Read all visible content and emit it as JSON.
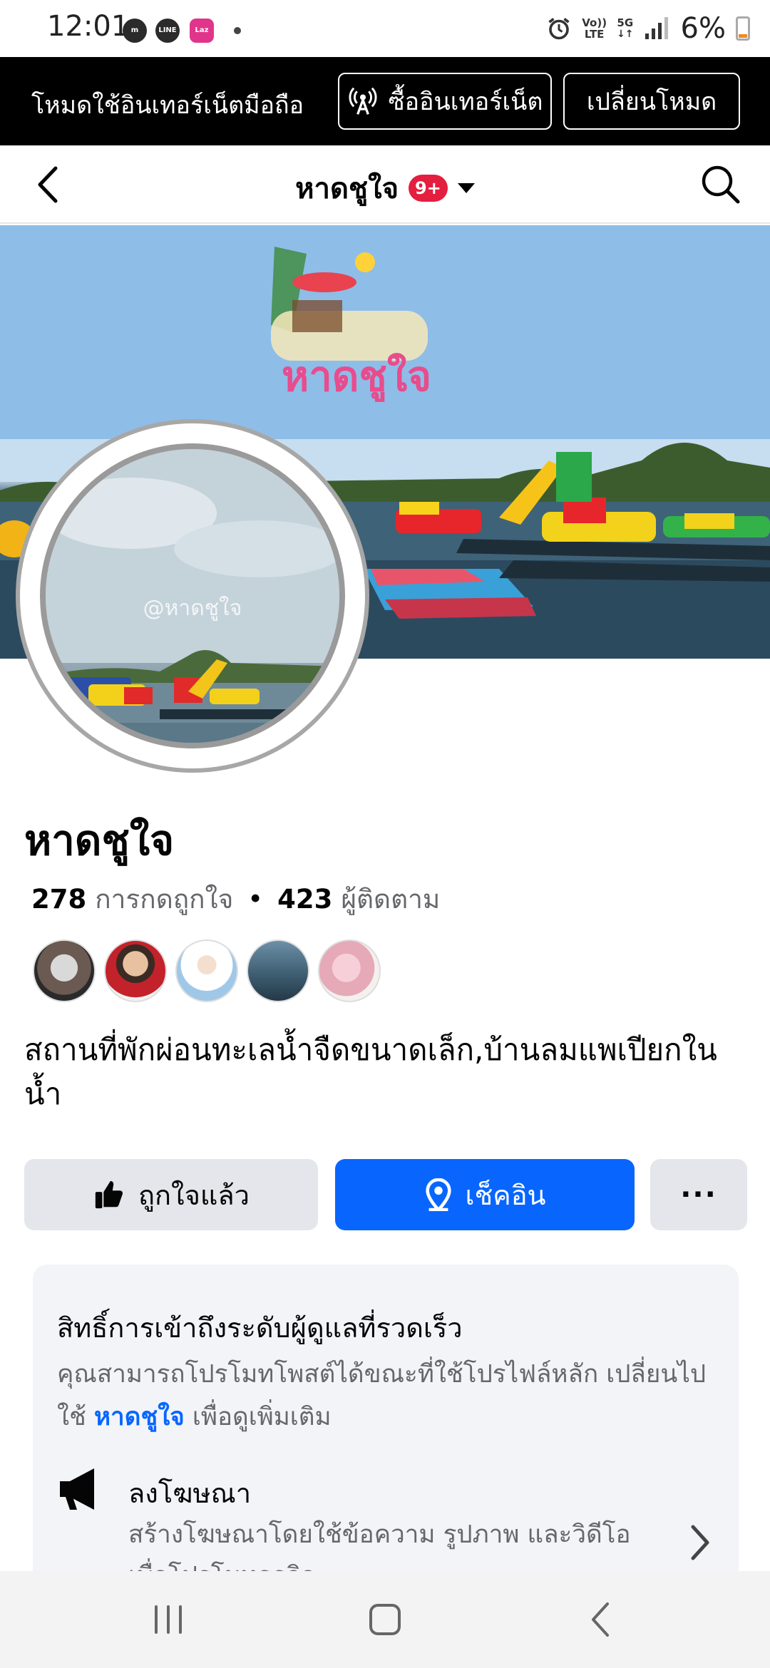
{
  "status_bar": {
    "time": "12:01",
    "apps": [
      "messenger-icon",
      "line-icon",
      "lazada-icon"
    ],
    "network_top": "Vo))",
    "network_bottom": "LTE",
    "five_g": "5G",
    "battery": "6%"
  },
  "mode_banner": {
    "text": "โหมดใช้อินเทอร์เน็ตมือถือ",
    "buy_label": "ซื้ออินเทอร์เน็ต",
    "switch_label": "เปลี่ยนโหมด"
  },
  "header": {
    "title": "หาดชูใจ",
    "badge": "9+"
  },
  "cover": {
    "logo_text": "หาดชูใจ"
  },
  "avatar": {
    "watermark": "@หาดชูใจ"
  },
  "page": {
    "name": "หาดชูใจ",
    "likes_count": "278",
    "likes_label": "การกดถูกใจ",
    "separator": "•",
    "followers_count": "423",
    "followers_label": "ผู้ติดตาม",
    "description": "สถานที่พักผ่อนทะเลน้ำจืดขนาดเล็ก,บ้านลมแพเปียกในน้ำ"
  },
  "actions": {
    "liked_label": "ถูกใจแล้ว",
    "checkin_label": "เช็คอิน",
    "more_label": "···"
  },
  "admin_card": {
    "title": "สิทธิ์การเข้าถึงระดับผู้ดูแลที่รวดเร็ว",
    "text_before": "คุณสามารถโปรโมทโพสต์ได้ขณะที่ใช้โปรไฟล์หลัก เปลี่ยนไปใช้ ",
    "link": "หาดชูใจ",
    "text_after": " เพื่อดูเพิ่มเติม",
    "ad_title": "ลงโฆษณา",
    "ad_desc": "สร้างโฆษณาโดยใช้ข้อความ รูปภาพ และวิดีโอ เพื่อโปรโมทธุรกิจ"
  },
  "colors": {
    "accent": "#0866ff",
    "badge": "#e41e3f",
    "button_gray": "#e4e6eb",
    "secondary_text": "#65676b"
  }
}
